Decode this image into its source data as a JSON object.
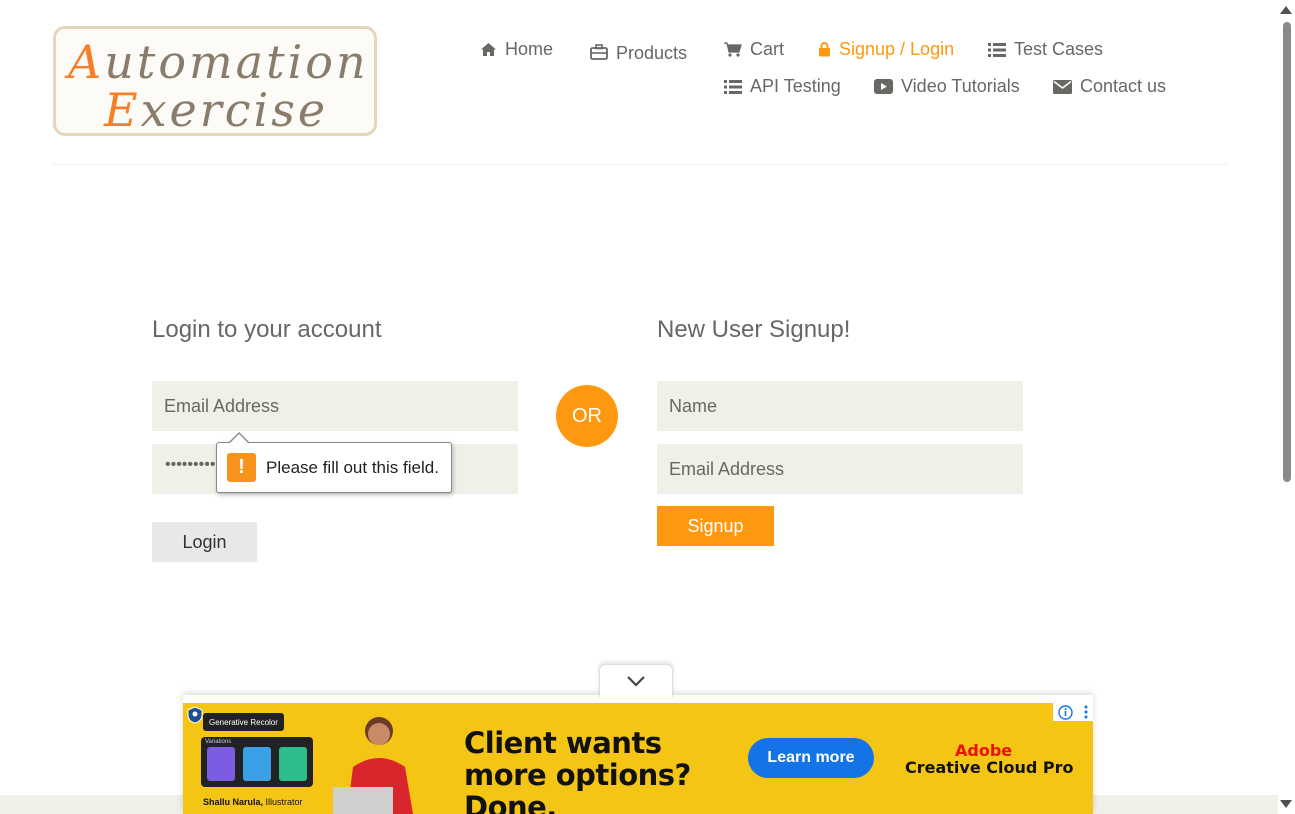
{
  "logo": {
    "line1_cap": "A",
    "line1_rest": "utomation",
    "line2_cap": "E",
    "line2_rest": "xercise"
  },
  "nav": {
    "home": "Home",
    "products": "Products",
    "cart": "Cart",
    "signup_login": "Signup / Login",
    "test_cases": "Test Cases",
    "api_testing": "API Testing",
    "video_tutorials": "Video Tutorials",
    "contact_us": "Contact us",
    "active_color": "#FE980F"
  },
  "login": {
    "title": "Login to your account",
    "email_placeholder": "Email Address",
    "password_masked": "•••••••••",
    "button": "Login"
  },
  "divider": {
    "or": "OR"
  },
  "signup": {
    "title": "New User Signup!",
    "name_placeholder": "Name",
    "email_placeholder": "Email Address",
    "button": "Signup"
  },
  "validation": {
    "message": "Please fill out this field."
  },
  "ad": {
    "headline": "Client wants more options? Done.",
    "cta": "Learn more",
    "brand_line1": "Adobe",
    "brand_line2": "Creative Cloud Pro",
    "feature_tag": "Generative Recolor",
    "variations": "Variations",
    "caption_name": "Shallu Narula,",
    "caption_role": " Illustrator",
    "background_color": "#F5C515",
    "cta_color": "#1473E6"
  }
}
